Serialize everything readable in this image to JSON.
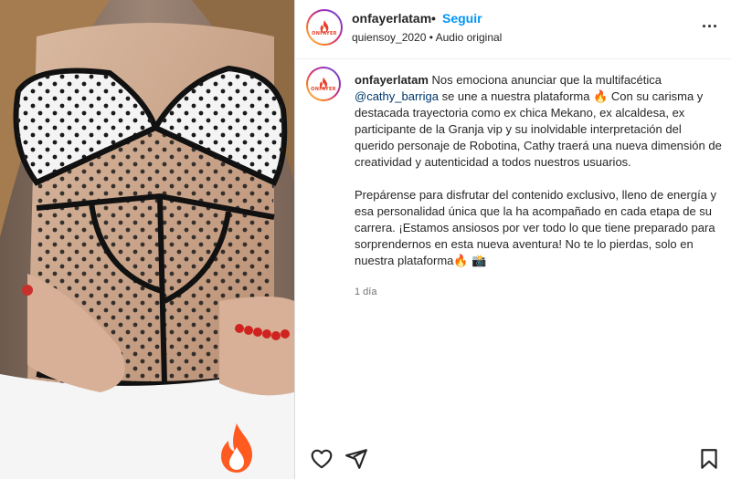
{
  "post": {
    "username": "onfayerlatam",
    "separator": "•",
    "follow_label": "Seguir",
    "subtitle": "quiensoy_2020 • Audio original",
    "more_label": "...",
    "avatar_text": "ONFAYER",
    "time_ago": "1 día"
  },
  "caption": {
    "username": "onfayerlatam",
    "text_1": " Nos emociona anunciar que la multifacética ",
    "mention": "@cathy_barriga",
    "text_2": " se une a nuestra plataforma 🔥 Con su carisma y destacada trayectoria como ex chica Mekano, ex alcaldesa, ex participante de la Granja vip y su inolvidable interpretación del querido personaje de Robotina, Cathy traerá una nueva dimensión de creatividad y autenticidad a todos nuestros usuarios.",
    "paragraph_2": "Prepárense para disfrutar del contenido exclusivo, lleno de energía y esa personalidad única que la ha acompañado en cada etapa de su carrera. ¡Estamos ansiosos por ver todo lo que tiene preparado para sorprendernos en esta nueva aventura! No te lo pierdas, solo en nuestra plataforma🔥 📸"
  },
  "icons": {
    "like": "heart-icon",
    "share": "send-icon",
    "save": "bookmark-icon",
    "brand": "flame-icon"
  },
  "colors": {
    "follow": "#0095f6",
    "mention": "#00376b",
    "brand": "#e8412b",
    "muted": "#737373"
  }
}
